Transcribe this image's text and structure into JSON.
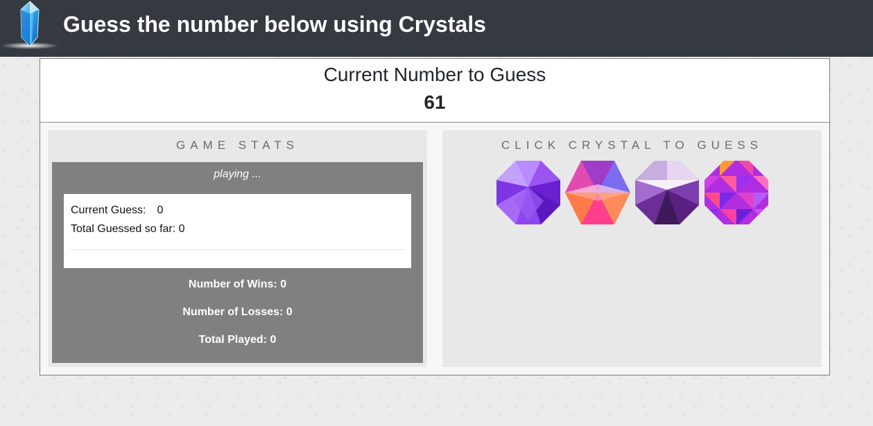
{
  "header": {
    "title": "Guess the number below using Crystals",
    "logo_icon": "crystal-logo-icon"
  },
  "target": {
    "title": "Current Number to Guess",
    "number": "61"
  },
  "stats": {
    "heading": "GAME STATS",
    "status": "playing ...",
    "current_guess_label": "Current Guess:",
    "current_guess_value": "0",
    "total_guessed_label": "Total Guessed so far:",
    "total_guessed_value": "0",
    "wins_label": "Number of Wins:",
    "wins_value": "0",
    "losses_label": "Number of Losses:",
    "losses_value": "0",
    "played_label": "Total Played:",
    "played_value": "0"
  },
  "crystals": {
    "heading": "CLICK CRYSTAL TO GUESS",
    "items": [
      {
        "icon": "purple-octagon-crystal-icon"
      },
      {
        "icon": "pink-hexagram-crystal-icon"
      },
      {
        "icon": "violet-faceted-crystal-icon"
      },
      {
        "icon": "mosaic-octagon-crystal-icon"
      }
    ]
  },
  "colors": {
    "header_bg": "#343a40",
    "stats_box_bg": "#808080",
    "panel_bg": "#e8e8e8"
  }
}
